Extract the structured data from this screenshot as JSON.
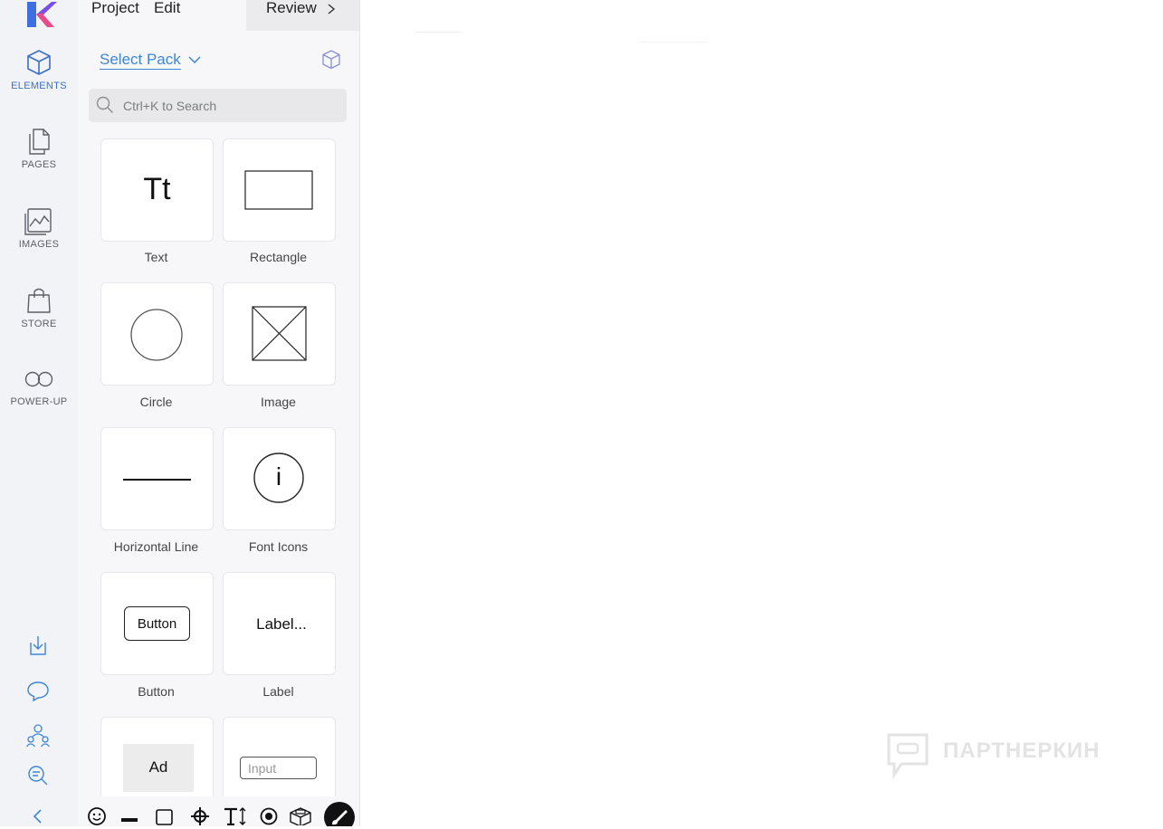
{
  "rail": {
    "items": [
      {
        "label": "ELEMENTS",
        "icon": "cube-icon",
        "active": true
      },
      {
        "label": "PAGES",
        "icon": "pages-icon",
        "active": false
      },
      {
        "label": "IMAGES",
        "icon": "image-icon",
        "active": false
      },
      {
        "label": "STORE",
        "icon": "shopping-bag-icon",
        "active": false
      },
      {
        "label": "POWER-UP",
        "icon": "infinity-icon",
        "active": false
      }
    ],
    "tools": [
      "download-icon",
      "comment-icon",
      "team-icon",
      "zoom-icon",
      "collapse-icon"
    ]
  },
  "menu": {
    "project": "Project",
    "edit": "Edit",
    "review": "Review"
  },
  "pack": {
    "label": "Select Pack"
  },
  "search": {
    "placeholder": "Ctrl+K to Search"
  },
  "elements": [
    {
      "label": "Text",
      "glyph_text": "Tt"
    },
    {
      "label": "Rectangle"
    },
    {
      "label": "Circle"
    },
    {
      "label": "Image"
    },
    {
      "label": "Horizontal Line"
    },
    {
      "label": "Font Icons",
      "glyph_text": "i"
    },
    {
      "label": "Button",
      "glyph_text": "Button"
    },
    {
      "label": "Label",
      "glyph_text": "Label..."
    },
    {
      "label": "",
      "glyph_text": "Ad"
    },
    {
      "label": "",
      "glyph_text": "Input"
    }
  ],
  "toolbar": [
    "emoji-icon",
    "line-icon",
    "square-icon",
    "move-icon",
    "text-size-icon",
    "radio-icon",
    "blocks-icon",
    "brush-icon"
  ],
  "watermark": {
    "text": "ПАРТНЕРКИН"
  },
  "colors": {
    "accent": "#3d86d6",
    "active_nav": "#3d6fc4",
    "rail_bg": "#f2f3f7"
  }
}
